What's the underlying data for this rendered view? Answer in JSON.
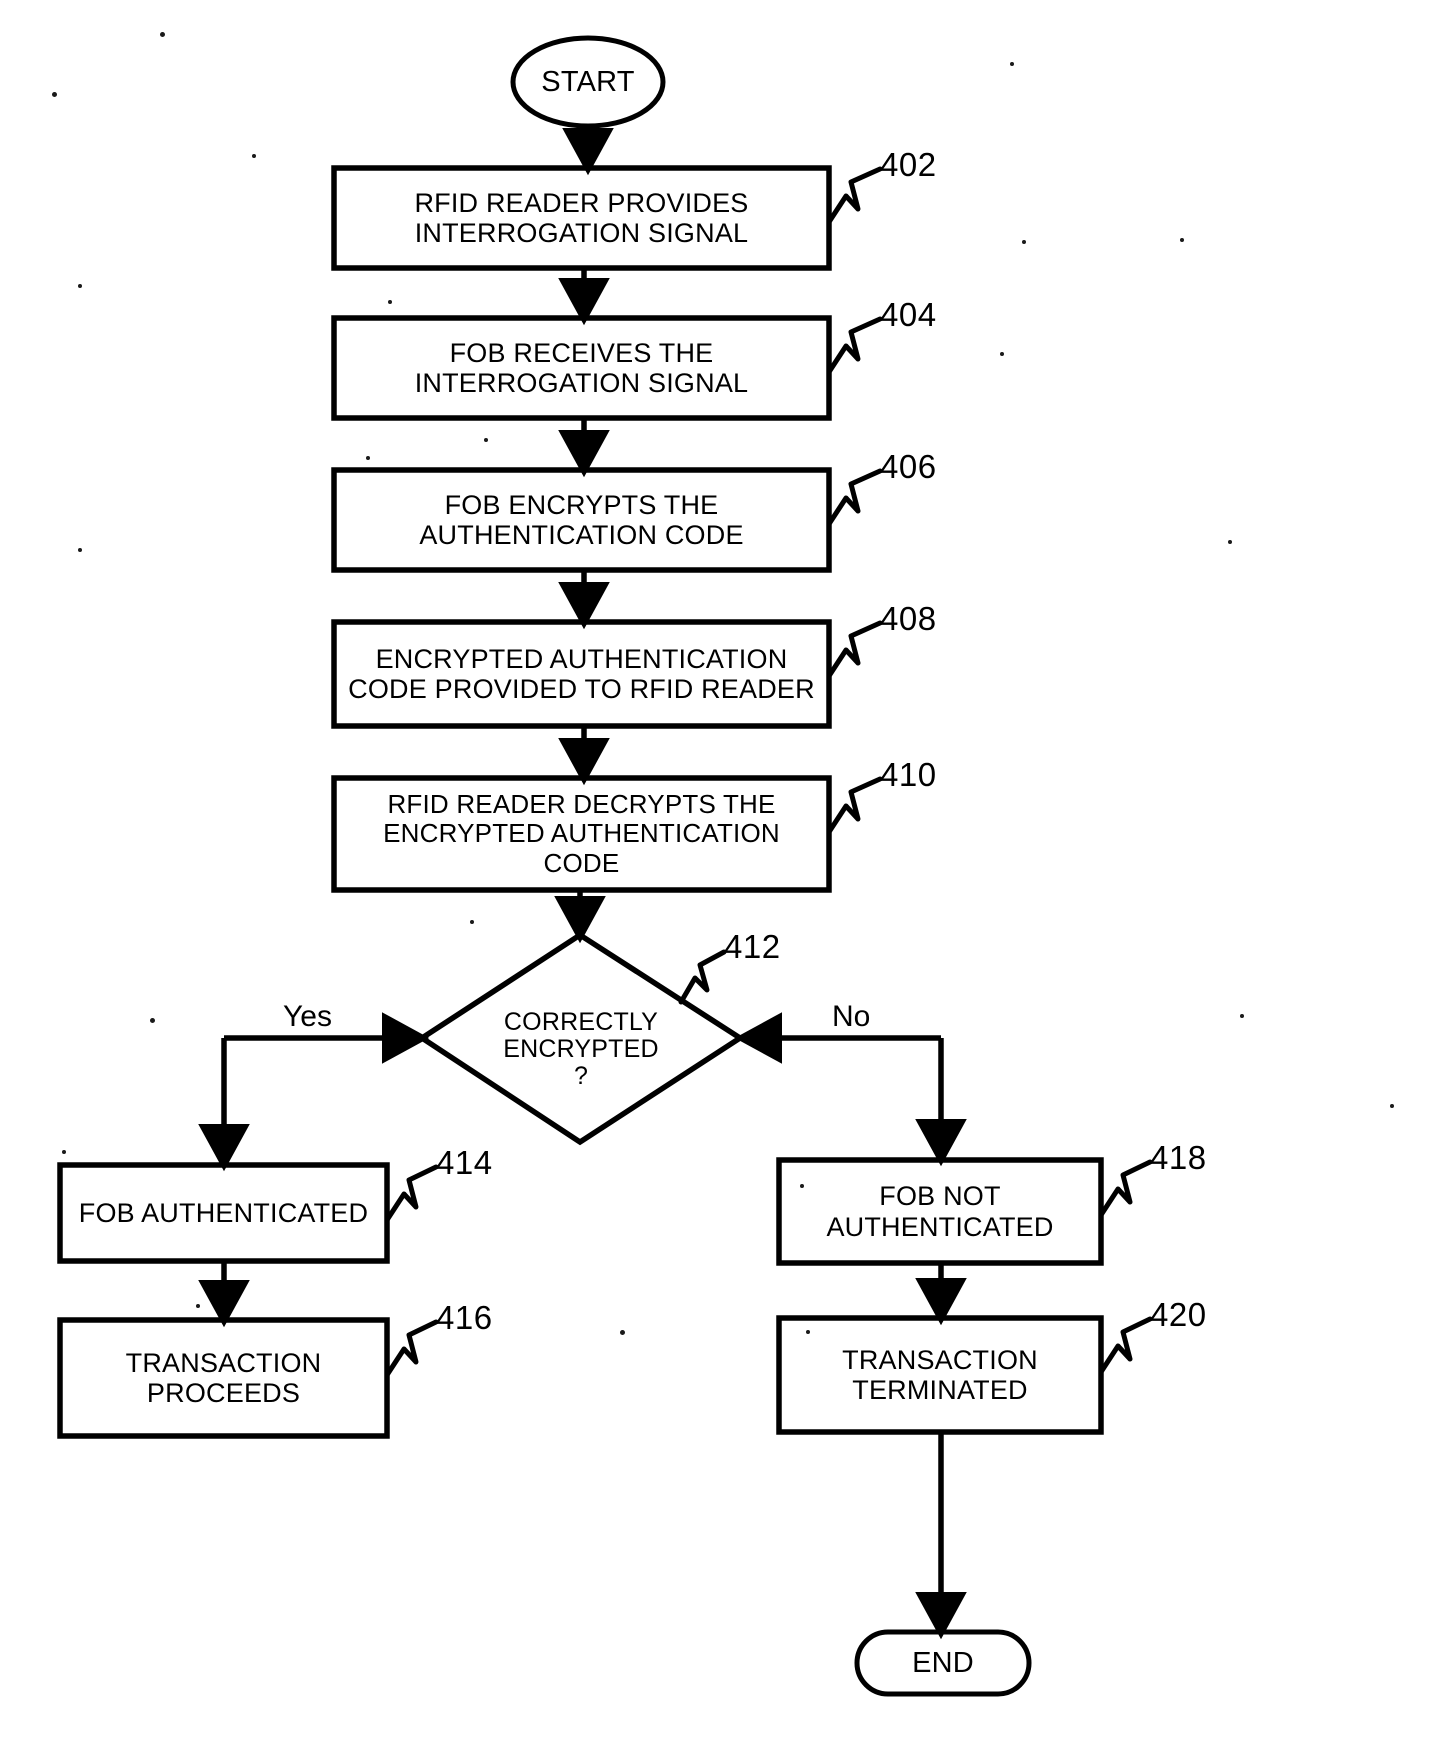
{
  "figure": {
    "type": "flowchart",
    "title": "RFID fob authentication process flowchart",
    "terminals": {
      "start": "START",
      "end": "END"
    },
    "nodes": [
      {
        "id": "start",
        "shape": "ellipse",
        "text": "START",
        "ref": ""
      },
      {
        "id": "n402",
        "shape": "rect",
        "text": "RFID READER PROVIDES\nINTERROGATION SIGNAL",
        "ref": "402"
      },
      {
        "id": "n404",
        "shape": "rect",
        "text": "FOB RECEIVES THE\nINTERROGATION SIGNAL",
        "ref": "404"
      },
      {
        "id": "n406",
        "shape": "rect",
        "text": "FOB ENCRYPTS THE\nAUTHENTICATION CODE",
        "ref": "406"
      },
      {
        "id": "n408",
        "shape": "rect",
        "text": "ENCRYPTED AUTHENTICATION\nCODE PROVIDED TO RFID READER",
        "ref": "408"
      },
      {
        "id": "n410",
        "shape": "rect",
        "text": "RFID READER DECRYPTS THE\nENCRYPTED AUTHENTICATION\nCODE",
        "ref": "410"
      },
      {
        "id": "n412",
        "shape": "diamond",
        "text": "CORRECTLY\nENCRYPTED\n?",
        "ref": "412"
      },
      {
        "id": "n414",
        "shape": "rect",
        "text": "FOB AUTHENTICATED",
        "ref": "414"
      },
      {
        "id": "n416",
        "shape": "rect",
        "text": "TRANSACTION\nPROCEEDS",
        "ref": "416"
      },
      {
        "id": "n418",
        "shape": "rect",
        "text": "FOB NOT\nAUTHENTICATED",
        "ref": "418"
      },
      {
        "id": "n420",
        "shape": "rect",
        "text": "TRANSACTION\nTERMINATED",
        "ref": "420"
      },
      {
        "id": "end",
        "shape": "stadium",
        "text": "END",
        "ref": ""
      }
    ],
    "edge_labels": {
      "yes": "Yes",
      "no": "No"
    },
    "refs": {
      "r402": "402",
      "r404": "404",
      "r406": "406",
      "r408": "408",
      "r410": "410",
      "r412": "412",
      "r414": "414",
      "r416": "416",
      "r418": "418",
      "r420": "420"
    },
    "colors": {
      "stroke": "#000000",
      "background": "#ffffff",
      "text": "#000000"
    }
  }
}
